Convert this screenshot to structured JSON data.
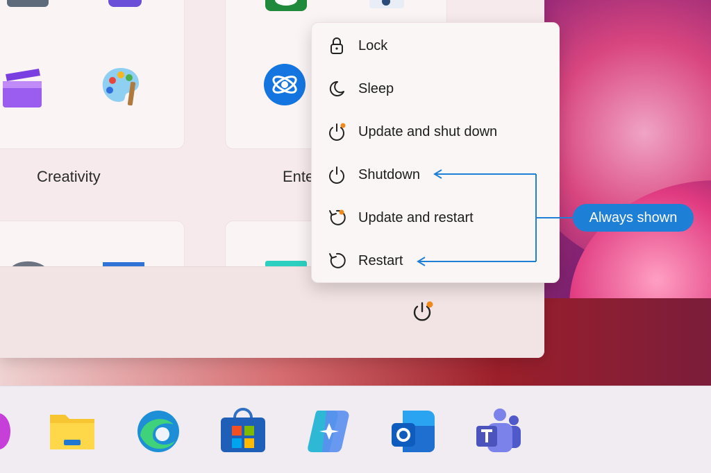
{
  "start_menu": {
    "groups": [
      "Creativity",
      "Ente"
    ]
  },
  "power_menu": {
    "items": [
      {
        "label": "Lock",
        "icon": "lock-icon"
      },
      {
        "label": "Sleep",
        "icon": "moon-icon"
      },
      {
        "label": "Update and shut down",
        "icon": "power-update-icon"
      },
      {
        "label": "Shutdown",
        "icon": "power-icon"
      },
      {
        "label": "Update and restart",
        "icon": "restart-update-icon"
      },
      {
        "label": "Restart",
        "icon": "restart-icon"
      }
    ]
  },
  "annotation": {
    "badge": "Always shown",
    "color": "#1e7fd6"
  },
  "taskbar": {
    "icons": [
      "copilot-icon",
      "file-explorer-icon",
      "edge-icon",
      "store-icon",
      "copilot-app-icon",
      "outlook-icon",
      "teams-icon"
    ]
  }
}
